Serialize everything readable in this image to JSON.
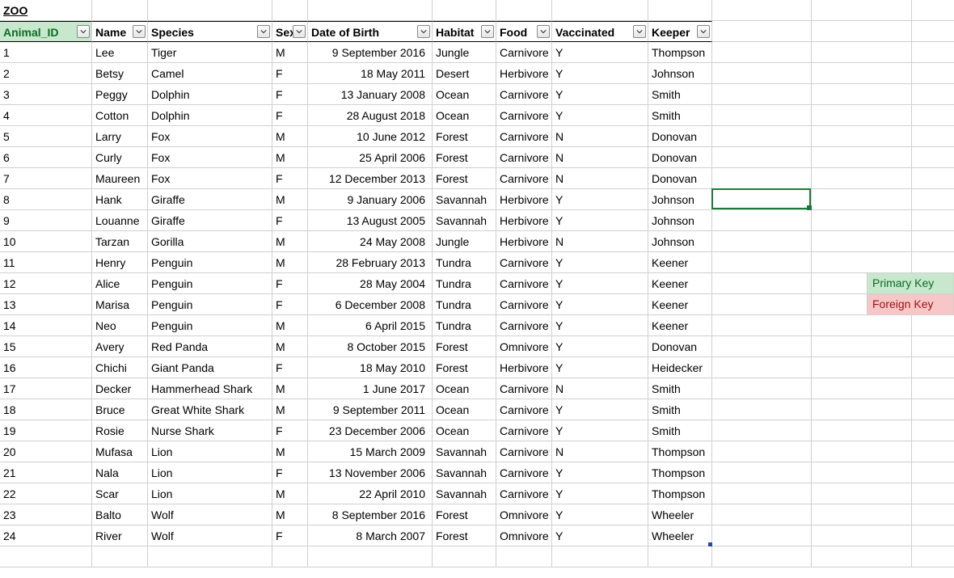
{
  "title": "ZOO",
  "columns": [
    "Animal_ID",
    "Name",
    "Species",
    "Sex",
    "Date of Birth",
    "Habitat",
    "Food",
    "Vaccinated",
    "Keeper"
  ],
  "rows": [
    {
      "id": "1",
      "name": "Lee",
      "species": "Tiger",
      "sex": "M",
      "dob": "9 September 2016",
      "habitat": "Jungle",
      "food": "Carnivore",
      "vac": "Y",
      "keeper": "Thompson"
    },
    {
      "id": "2",
      "name": "Betsy",
      "species": "Camel",
      "sex": "F",
      "dob": "18 May 2011",
      "habitat": "Desert",
      "food": "Herbivore",
      "vac": "Y",
      "keeper": "Johnson"
    },
    {
      "id": "3",
      "name": "Peggy",
      "species": "Dolphin",
      "sex": "F",
      "dob": "13 January 2008",
      "habitat": "Ocean",
      "food": "Carnivore",
      "vac": "Y",
      "keeper": "Smith"
    },
    {
      "id": "4",
      "name": "Cotton",
      "species": "Dolphin",
      "sex": "F",
      "dob": "28 August 2018",
      "habitat": "Ocean",
      "food": "Carnivore",
      "vac": "Y",
      "keeper": "Smith"
    },
    {
      "id": "5",
      "name": "Larry",
      "species": "Fox",
      "sex": "M",
      "dob": "10 June 2012",
      "habitat": "Forest",
      "food": "Carnivore",
      "vac": "N",
      "keeper": "Donovan"
    },
    {
      "id": "6",
      "name": "Curly",
      "species": "Fox",
      "sex": "M",
      "dob": "25 April 2006",
      "habitat": "Forest",
      "food": "Carnivore",
      "vac": "N",
      "keeper": "Donovan"
    },
    {
      "id": "7",
      "name": "Maureen",
      "species": "Fox",
      "sex": "F",
      "dob": "12 December 2013",
      "habitat": "Forest",
      "food": "Carnivore",
      "vac": "N",
      "keeper": "Donovan"
    },
    {
      "id": "8",
      "name": "Hank",
      "species": "Giraffe",
      "sex": "M",
      "dob": "9 January 2006",
      "habitat": "Savannah",
      "food": "Herbivore",
      "vac": "Y",
      "keeper": "Johnson"
    },
    {
      "id": "9",
      "name": "Louanne",
      "species": "Giraffe",
      "sex": "F",
      "dob": "13 August 2005",
      "habitat": "Savannah",
      "food": "Herbivore",
      "vac": "Y",
      "keeper": "Johnson"
    },
    {
      "id": "10",
      "name": "Tarzan",
      "species": "Gorilla",
      "sex": "M",
      "dob": "24 May 2008",
      "habitat": "Jungle",
      "food": "Herbivore",
      "vac": "N",
      "keeper": "Johnson"
    },
    {
      "id": "11",
      "name": "Henry",
      "species": "Penguin",
      "sex": "M",
      "dob": "28 February 2013",
      "habitat": "Tundra",
      "food": "Carnivore",
      "vac": "Y",
      "keeper": "Keener"
    },
    {
      "id": "12",
      "name": "Alice",
      "species": "Penguin",
      "sex": "F",
      "dob": "28 May 2004",
      "habitat": "Tundra",
      "food": "Carnivore",
      "vac": "Y",
      "keeper": "Keener"
    },
    {
      "id": "13",
      "name": "Marisa",
      "species": "Penguin",
      "sex": "F",
      "dob": "6 December 2008",
      "habitat": "Tundra",
      "food": "Carnivore",
      "vac": "Y",
      "keeper": "Keener"
    },
    {
      "id": "14",
      "name": "Neo",
      "species": "Penguin",
      "sex": "M",
      "dob": "6 April 2015",
      "habitat": "Tundra",
      "food": "Carnivore",
      "vac": "Y",
      "keeper": "Keener"
    },
    {
      "id": "15",
      "name": "Avery",
      "species": "Red Panda",
      "sex": "M",
      "dob": "8 October 2015",
      "habitat": "Forest",
      "food": "Omnivore",
      "vac": "Y",
      "keeper": "Donovan"
    },
    {
      "id": "16",
      "name": "Chichi",
      "species": "Giant Panda",
      "sex": "F",
      "dob": "18 May 2010",
      "habitat": "Forest",
      "food": "Herbivore",
      "vac": "Y",
      "keeper": "Heidecker"
    },
    {
      "id": "17",
      "name": "Decker",
      "species": "Hammerhead Shark",
      "sex": "M",
      "dob": "1 June 2017",
      "habitat": "Ocean",
      "food": "Carnivore",
      "vac": "N",
      "keeper": "Smith"
    },
    {
      "id": "18",
      "name": "Bruce",
      "species": "Great White Shark",
      "sex": "M",
      "dob": "9 September 2011",
      "habitat": "Ocean",
      "food": "Carnivore",
      "vac": "Y",
      "keeper": "Smith"
    },
    {
      "id": "19",
      "name": "Rosie",
      "species": "Nurse Shark",
      "sex": "F",
      "dob": "23 December 2006",
      "habitat": "Ocean",
      "food": "Carnivore",
      "vac": "Y",
      "keeper": "Smith"
    },
    {
      "id": "20",
      "name": "Mufasa",
      "species": "Lion",
      "sex": "M",
      "dob": "15 March 2009",
      "habitat": "Savannah",
      "food": "Carnivore",
      "vac": "N",
      "keeper": "Thompson"
    },
    {
      "id": "21",
      "name": "Nala",
      "species": "Lion",
      "sex": "F",
      "dob": "13 November 2006",
      "habitat": "Savannah",
      "food": "Carnivore",
      "vac": "Y",
      "keeper": "Thompson"
    },
    {
      "id": "22",
      "name": "Scar",
      "species": "Lion",
      "sex": "M",
      "dob": "22 April 2010",
      "habitat": "Savannah",
      "food": "Carnivore",
      "vac": "Y",
      "keeper": "Thompson"
    },
    {
      "id": "23",
      "name": "Balto",
      "species": "Wolf",
      "sex": "M",
      "dob": "8 September 2016",
      "habitat": "Forest",
      "food": "Omnivore",
      "vac": "Y",
      "keeper": "Wheeler"
    },
    {
      "id": "24",
      "name": "River",
      "species": "Wolf",
      "sex": "F",
      "dob": "8 March 2007",
      "habitat": "Forest",
      "food": "Omnivore",
      "vac": "Y",
      "keeper": "Wheeler"
    }
  ],
  "legend": {
    "pk": "Primary Key",
    "fk": "Foreign Key"
  },
  "selection": {
    "row_index": 8,
    "col_after_table": true
  }
}
